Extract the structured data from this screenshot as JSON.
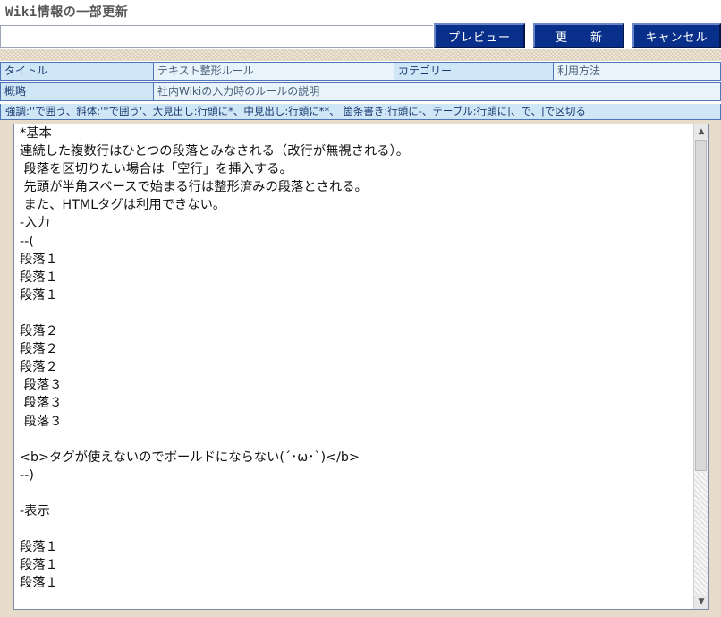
{
  "header": {
    "title": "Wiki情報の一部更新"
  },
  "toolbar": {
    "summary_value": "",
    "preview_label": "プレビュー",
    "update_label": "更　　新",
    "cancel_label": "キャンセル"
  },
  "meta": {
    "title_label": "タイトル",
    "title_value": "テキスト整形ルール",
    "category_label": "カテゴリー",
    "category_value": "利用方法",
    "summary_label": "概略",
    "summary_value": "社内Wikiの入力時のルールの説明"
  },
  "hint": "強調:''で囲う、斜体:'''で囲う'、大見出し:行頭に*、中見出し:行頭に**、 箇条書き:行頭に-、テーブル:行頭に|、で、|で区切る",
  "editor": {
    "content": "*基本\n連続した複数行はひとつの段落とみなされる（改行が無視される）。\n 段落を区切りたい場合は「空行」を挿入する。\n 先頭が半角スペースで始まる行は整形済みの段落とされる。\n また、HTMLタグは利用できない。\n-入力\n--(\n段落１\n段落１\n段落１\n\n段落２\n段落２\n段落２\n 段落３\n 段落３\n 段落３\n\n<b>タグが使えないのでボールドにならない(´･ω･`)</b>\n--)\n\n-表示\n\n段落１\n段落１\n段落１"
  },
  "icons": {
    "scroll_up": "scroll-up-arrow-icon",
    "scroll_down": "scroll-down-arrow-icon"
  },
  "colors": {
    "button_bg": "#08308a",
    "label_bg": "#cfe6f7",
    "value_bg": "#e8f3fc",
    "border": "#4f74b8"
  }
}
